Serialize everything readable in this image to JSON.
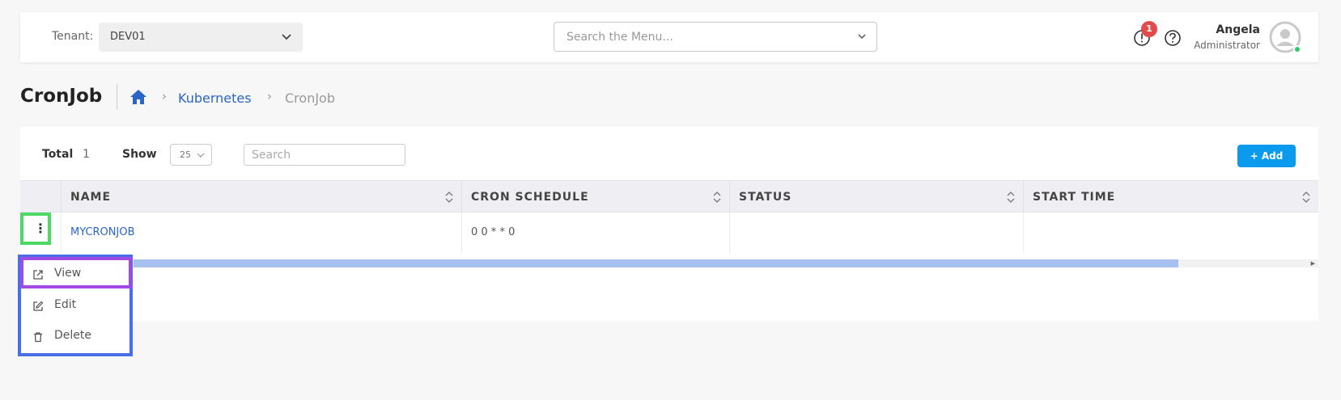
{
  "header": {
    "tenant_label": "Tenant:",
    "tenant_value": "DEV01",
    "menu_search_placeholder": "Search the Menu...",
    "alert_count": "1",
    "user_name": "Angela",
    "user_role": "Administrator"
  },
  "page": {
    "title": "CronJob",
    "breadcrumb": [
      "Kubernetes",
      "CronJob"
    ]
  },
  "toolbar": {
    "total_label": "Total",
    "total_value": "1",
    "show_label": "Show",
    "show_value": "25",
    "search_placeholder": "Search",
    "add_label": "+ Add"
  },
  "table": {
    "columns": [
      "NAME",
      "CRON SCHEDULE",
      "STATUS",
      "START TIME"
    ],
    "rows": [
      {
        "name": "MYCRONJOB",
        "schedule": "0 0 * * 0",
        "status": "",
        "start_time": ""
      }
    ]
  },
  "row_menu": {
    "items": [
      "View",
      "Edit",
      "Delete"
    ]
  },
  "colors": {
    "accent": "#0a9aee",
    "link": "#2a66c7",
    "badge": "#e24b4b"
  }
}
